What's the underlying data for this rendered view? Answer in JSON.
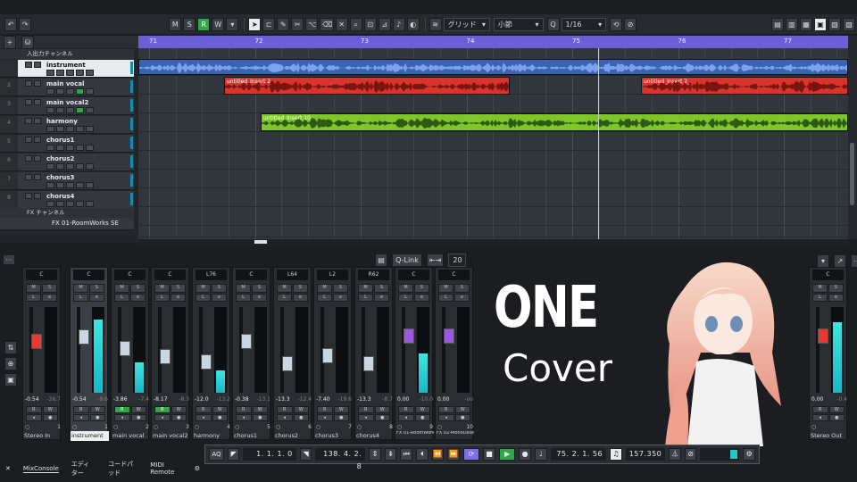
{
  "toolbar": {
    "m": "M",
    "s": "S",
    "r": "R",
    "w": "W",
    "snap_type": "グリッド",
    "grid_type": "小節",
    "quantize": "1/16"
  },
  "tracklist": {
    "input_folder": "入出力チャンネル",
    "fx_folder": "FX チャンネル",
    "fx_badge": "FX",
    "tracks": [
      {
        "num": "",
        "name": "instrument"
      },
      {
        "num": "2",
        "name": "main   vocal"
      },
      {
        "num": "3",
        "name": "main   vocal2"
      },
      {
        "num": "4",
        "name": "harmony"
      },
      {
        "num": "5",
        "name": "chorus1"
      },
      {
        "num": "6",
        "name": "chorus2"
      },
      {
        "num": "7",
        "name": "chorus3"
      },
      {
        "num": "8",
        "name": "chorus4"
      }
    ],
    "fx_track": "FX 01-RoomWorks SE"
  },
  "ruler": {
    "bars": [
      "71",
      "72",
      "73",
      "74",
      "75",
      "76",
      "77"
    ]
  },
  "clips": {
    "vocal_a": "untitled_Insert 2_",
    "vocal_b": "untitled_Insert 2_",
    "harmony": "untitled_Insert 10_"
  },
  "mixer": {
    "qlink": "Q-Link",
    "count": "20",
    "strips": [
      {
        "pan": "C",
        "val": "-0.54",
        "peak": "-26.7",
        "idx": "1",
        "name": "Stereo In"
      },
      {
        "pan": "C",
        "val": "-0.54",
        "peak": "-9.6",
        "idx": "1",
        "name": "instrument"
      },
      {
        "pan": "C",
        "val": "-3.86",
        "peak": "-7.4",
        "idx": "2",
        "name": "main   vocal"
      },
      {
        "pan": "C",
        "val": "-8.17",
        "peak": "-8.3",
        "idx": "3",
        "name": "main   vocal2"
      },
      {
        "pan": "L76",
        "val": "-12.0",
        "peak": "-13.2",
        "idx": "4",
        "name": "harmony"
      },
      {
        "pan": "C",
        "val": "-0.38",
        "peak": "-13.1",
        "idx": "5",
        "name": "chorus1"
      },
      {
        "pan": "L64",
        "val": "-13.3",
        "peak": "-12.4",
        "idx": "6",
        "name": "chorus2"
      },
      {
        "pan": "L2",
        "val": "-7.40",
        "peak": "-19.6",
        "idx": "7",
        "name": "chorus3"
      },
      {
        "pan": "R62",
        "val": "-13.3",
        "peak": "-8.7",
        "idx": "8",
        "name": "chorus4"
      },
      {
        "pan": "C",
        "val": "0.00",
        "peak": "-10.0",
        "idx": "9",
        "name": "FX 01-RoomWorks S"
      },
      {
        "pan": "C",
        "val": "0.00",
        "peak": "-oo",
        "idx": "10",
        "name": "FX 02-MonoDelay"
      },
      {
        "pan": "C",
        "val": "0.00",
        "peak": "-0.4",
        "idx": "",
        "name": "Stereo Out"
      }
    ]
  },
  "cover": {
    "title": "ONE",
    "subtitle": "Cover"
  },
  "tabs": [
    "MixConsole",
    "エディター",
    "コードパッド",
    "MIDI Remote"
  ],
  "transport": {
    "aq": "AQ",
    "left_locator": "1. 1. 1.   0",
    "right_locator": "138. 4. 2.   8",
    "position": "75. 2. 1. 56",
    "tempo": "157.350"
  }
}
